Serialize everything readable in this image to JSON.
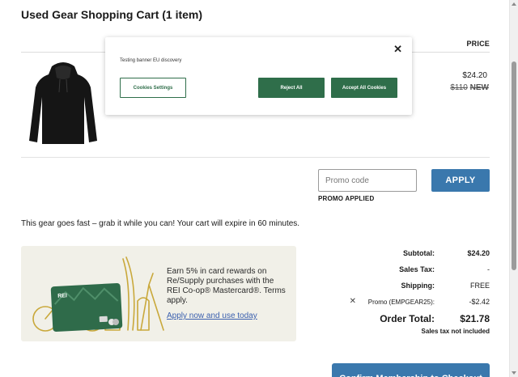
{
  "cart": {
    "title": "Used Gear Shopping Cart (1 item)",
    "price_header": "PRICE"
  },
  "item": {
    "image": "black-hoodie-product-image",
    "price": "$24.20",
    "original_price": "$110",
    "tag": "NEW"
  },
  "promo": {
    "placeholder": "Promo code",
    "apply_label": "APPLY",
    "status": "PROMO APPLIED"
  },
  "message": "This gear goes fast – grab it while you can! Your cart will expire in 60 minutes.",
  "card_offer": {
    "text": "Earn 5% in card rewards on Re/Supply purchases with the REI Co-op® Mastercard®. Terms apply.",
    "link": "Apply now and use today",
    "card_logo": "REI"
  },
  "summary": {
    "subtotal_label": "Subtotal:",
    "subtotal_value": "$24.20",
    "tax_label": "Sales Tax:",
    "tax_value": "-",
    "shipping_label": "Shipping:",
    "shipping_value": "FREE",
    "promo_label": "Promo (EMPGEAR25):",
    "promo_value": "-$2.42",
    "remove_icon": "close-icon",
    "total_label": "Order Total:",
    "total_value": "$21.78",
    "tax_note": "Sales tax not included"
  },
  "checkout": {
    "button_label": "Confirm Membership to Checkout"
  },
  "cookie_banner": {
    "text": "Testing banner EU discovery",
    "settings_label": "Cookies Settings",
    "reject_label": "Reject All",
    "accept_label": "Accept All Cookies",
    "close_icon": "close-icon"
  },
  "colors": {
    "primary_button": "#3a78ad",
    "cookie_green": "#2f6e4a",
    "card_panel": "#f1f0e8",
    "link": "#3a5fae"
  }
}
